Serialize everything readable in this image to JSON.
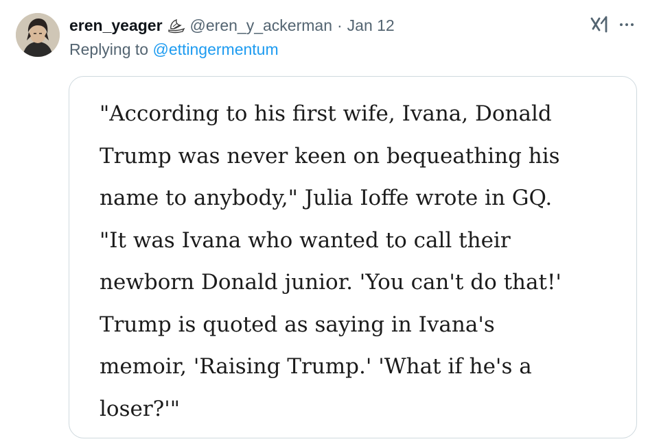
{
  "tweet": {
    "display_name": "eren_yeager",
    "handle": "@eren_y_ackerman",
    "separator": "·",
    "date": "Jan 12",
    "replying_prefix": "Replying to ",
    "replying_to": "@ettingermentum"
  },
  "media": {
    "quote_lines": [
      "\"According to his first wife, Ivana, Donald",
      "Trump was never keen on bequeathing his",
      "name to anybody,\" Julia Ioffe wrote in GQ.",
      "\"It was Ivana who wanted to call their",
      "newborn Donald junior. 'You can't do that!'",
      "Trump is quoted as saying in Ivana's",
      "memoir, 'Raising Trump.' 'What if he's a",
      "loser?'\""
    ]
  },
  "icons": {
    "avatar": "profile-avatar",
    "badge": "wing-emoji-icon",
    "grok": "grok-icon",
    "more": "more-icon"
  },
  "colors": {
    "secondary_text": "#536471",
    "link": "#1d9bf0",
    "card_border": "#cfd9de"
  }
}
